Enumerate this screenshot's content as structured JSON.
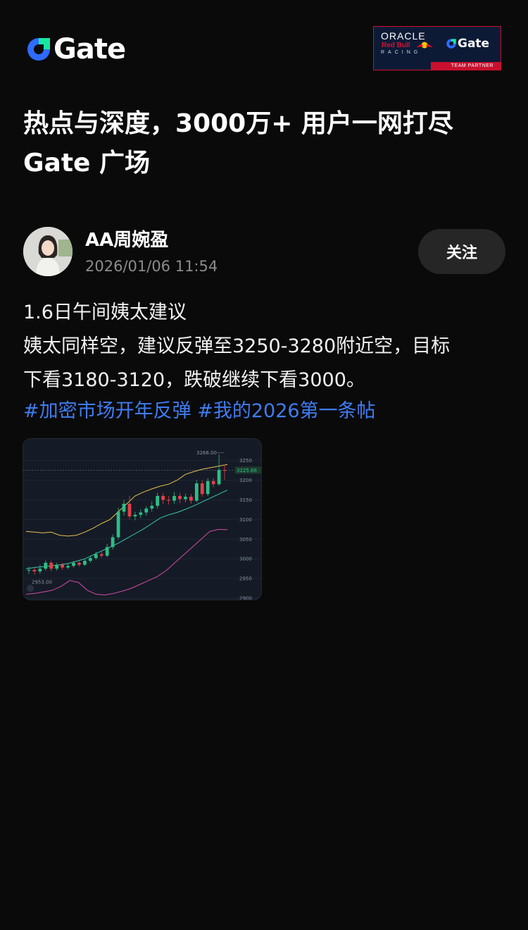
{
  "header": {
    "logo_text": "Gate",
    "logo_icon": "gate-logo-icon",
    "partner": {
      "oracle": "ORACLE",
      "redbull": "Red Bull",
      "racing": "RACING",
      "gate": "Gate",
      "badge": "TEAM PARTNER"
    }
  },
  "headline": {
    "line1": "热点与深度，3000万+ 用户一网打尽",
    "line2": "Gate 广场"
  },
  "post": {
    "author": "AA周婉盈",
    "timestamp": "2026/01/06 11:54",
    "follow_label": "关注",
    "body_lines": [
      "1.6日午间姨太建议",
      "姨太同样空，建议反弹至3250-3280附近空，目标",
      "下看3180-3120，跌破继续下看3000。"
    ],
    "tags": [
      "#加密市场开年反弹",
      "#我的2026第一条帖"
    ]
  },
  "chart_data": {
    "type": "candlestick",
    "y_ticks": [
      "3250",
      "3200",
      "3150",
      "3100",
      "3050",
      "3000",
      "2950",
      "2900"
    ],
    "ylim": [
      2900,
      3280
    ],
    "high_label": "3266.00",
    "low_label": "2953.00",
    "current_price": "3225.66",
    "candles": [
      {
        "o": 2970,
        "c": 2972,
        "h": 2980,
        "l": 2962
      },
      {
        "o": 2972,
        "c": 2968,
        "h": 2978,
        "l": 2960
      },
      {
        "o": 2968,
        "c": 2975,
        "h": 2985,
        "l": 2962
      },
      {
        "o": 2975,
        "c": 2990,
        "h": 2996,
        "l": 2970
      },
      {
        "o": 2990,
        "c": 2975,
        "h": 2995,
        "l": 2968
      },
      {
        "o": 2975,
        "c": 2985,
        "h": 2990,
        "l": 2970
      },
      {
        "o": 2985,
        "c": 2978,
        "h": 2990,
        "l": 2972
      },
      {
        "o": 2978,
        "c": 2982,
        "h": 2988,
        "l": 2974
      },
      {
        "o": 2982,
        "c": 2990,
        "h": 2995,
        "l": 2978
      },
      {
        "o": 2990,
        "c": 2985,
        "h": 2994,
        "l": 2980
      },
      {
        "o": 2985,
        "c": 2995,
        "h": 3000,
        "l": 2982
      },
      {
        "o": 2995,
        "c": 3002,
        "h": 3008,
        "l": 2990
      },
      {
        "o": 3002,
        "c": 3012,
        "h": 3018,
        "l": 2998
      },
      {
        "o": 3012,
        "c": 3008,
        "h": 3020,
        "l": 3002
      },
      {
        "o": 3008,
        "c": 3030,
        "h": 3038,
        "l": 3004
      },
      {
        "o": 3030,
        "c": 3055,
        "h": 3062,
        "l": 3024
      },
      {
        "o": 3055,
        "c": 3120,
        "h": 3130,
        "l": 3050
      },
      {
        "o": 3120,
        "c": 3140,
        "h": 3150,
        "l": 3110
      },
      {
        "o": 3140,
        "c": 3108,
        "h": 3160,
        "l": 3100
      },
      {
        "o": 3108,
        "c": 3112,
        "h": 3120,
        "l": 3098
      },
      {
        "o": 3112,
        "c": 3118,
        "h": 3126,
        "l": 3104
      },
      {
        "o": 3118,
        "c": 3128,
        "h": 3134,
        "l": 3110
      },
      {
        "o": 3128,
        "c": 3135,
        "h": 3146,
        "l": 3120
      },
      {
        "o": 3135,
        "c": 3160,
        "h": 3168,
        "l": 3128
      },
      {
        "o": 3160,
        "c": 3150,
        "h": 3168,
        "l": 3140
      },
      {
        "o": 3150,
        "c": 3148,
        "h": 3160,
        "l": 3138
      },
      {
        "o": 3148,
        "c": 3160,
        "h": 3170,
        "l": 3140
      },
      {
        "o": 3160,
        "c": 3152,
        "h": 3168,
        "l": 3142
      },
      {
        "o": 3152,
        "c": 3158,
        "h": 3166,
        "l": 3144
      },
      {
        "o": 3158,
        "c": 3148,
        "h": 3165,
        "l": 3140
      },
      {
        "o": 3148,
        "c": 3192,
        "h": 3200,
        "l": 3144
      },
      {
        "o": 3192,
        "c": 3165,
        "h": 3200,
        "l": 3158
      },
      {
        "o": 3165,
        "c": 3198,
        "h": 3205,
        "l": 3160
      },
      {
        "o": 3198,
        "c": 3190,
        "h": 3206,
        "l": 3182
      },
      {
        "o": 3190,
        "c": 3226,
        "h": 3266,
        "l": 3186
      },
      {
        "o": 3226,
        "c": 3224,
        "h": 3240,
        "l": 3200
      }
    ],
    "upper_band": [
      3070,
      3068,
      3066,
      3068,
      3060,
      3058,
      3060,
      3068,
      3078,
      3090,
      3100,
      3120,
      3140,
      3160,
      3170,
      3178,
      3185,
      3190,
      3200,
      3215,
      3222,
      3228,
      3232,
      3236,
      3240
    ],
    "middle_band": [
      2975,
      2978,
      2980,
      2982,
      2985,
      2988,
      2994,
      3000,
      3010,
      3020,
      3030,
      3040,
      3052,
      3064,
      3076,
      3090,
      3104,
      3112,
      3118,
      3126,
      3135,
      3145,
      3155,
      3165,
      3175
    ],
    "lower_band": [
      2910,
      2912,
      2916,
      2920,
      2930,
      2945,
      2940,
      2920,
      2910,
      2908,
      2912,
      2918,
      2925,
      2935,
      2945,
      2955,
      2970,
      2990,
      3010,
      3030,
      3050,
      3070,
      3075,
      3074
    ],
    "colors": {
      "up": "#2ebd85",
      "down": "#e2404a",
      "upper": "#e8c14d",
      "middle": "#38c9b0",
      "lower": "#d449a8"
    }
  }
}
